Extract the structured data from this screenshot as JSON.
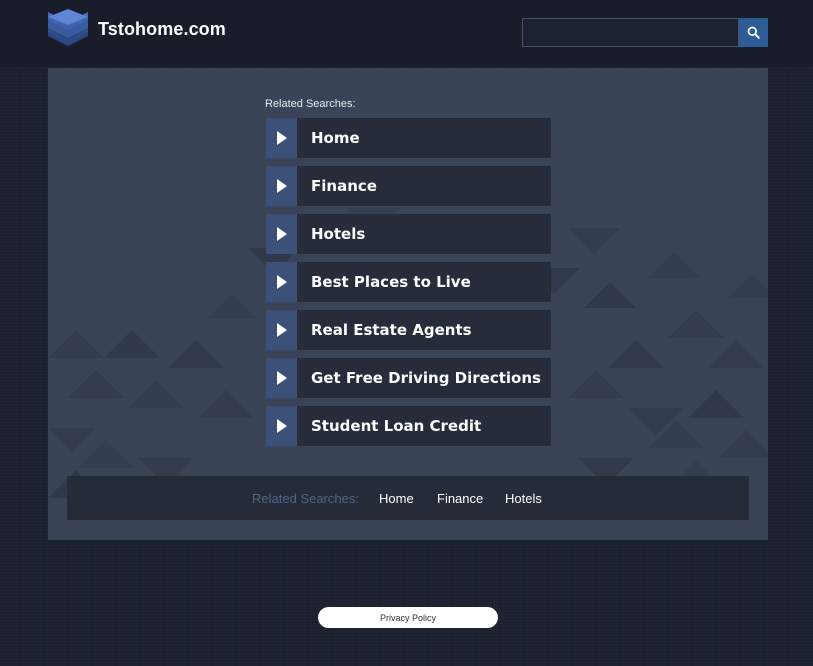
{
  "header": {
    "site_title": "Tstohome.com",
    "logo_icon": "stacked-layers-icon",
    "search": {
      "value": "",
      "placeholder": "",
      "button_icon": "search-icon"
    }
  },
  "main": {
    "related_label": "Related Searches:",
    "links": [
      {
        "label": "Home"
      },
      {
        "label": "Finance"
      },
      {
        "label": "Hotels"
      },
      {
        "label": "Best Places to Live"
      },
      {
        "label": "Real Estate Agents"
      },
      {
        "label": "Get Free Driving Directions"
      },
      {
        "label": "Student Loan Credit"
      }
    ],
    "link_arrow_icon": "play-arrow-icon"
  },
  "bottom_bar": {
    "label": "Related Searches:",
    "links": [
      "Home",
      "Finance",
      "Hotels"
    ]
  },
  "footer": {
    "privacy_label": "Privacy Policy"
  },
  "colors": {
    "page_bg": "#1c2230",
    "header_bg": "#181d29",
    "panel_bg": "#3b4457",
    "link_box_bg": "#262c39",
    "arrow_box_bg": "#3d5077",
    "search_button_bg": "#2d5b94",
    "bottom_label_color": "#53658a"
  }
}
